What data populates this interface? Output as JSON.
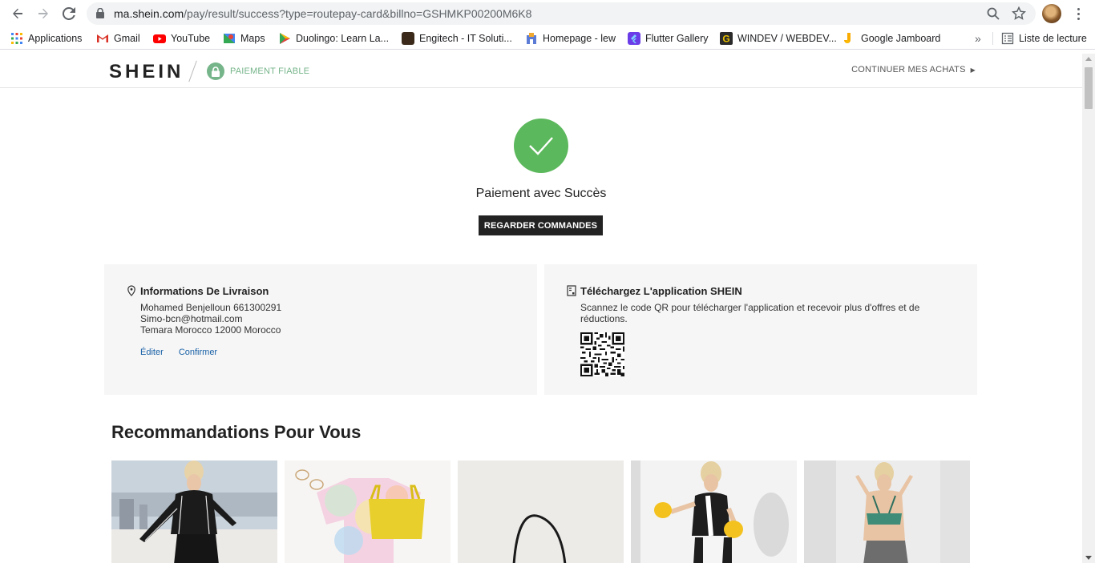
{
  "browser": {
    "url_host": "ma.shein.com",
    "url_path": "/pay/result/success?type=routepay-card&billno=GSHMKP00200M6K8",
    "bookmarks": [
      {
        "label": "Applications",
        "icon": "apps-grid-icon"
      },
      {
        "label": "Gmail",
        "icon": "gmail-icon",
        "color": "#d93025"
      },
      {
        "label": "YouTube",
        "icon": "youtube-icon",
        "color": "#ff0000"
      },
      {
        "label": "Maps",
        "icon": "maps-icon",
        "color": "#34a853"
      },
      {
        "label": "Duolingo: Learn La...",
        "icon": "play-store-icon",
        "color": "#4285f4"
      },
      {
        "label": "Engitech - IT Soluti...",
        "icon": "engitech-icon",
        "color": "#3b2a1a"
      },
      {
        "label": "Homepage - lew",
        "icon": "homepage-icon",
        "color": "#5b7bd5"
      },
      {
        "label": "Flutter Gallery",
        "icon": "flutter-icon",
        "color": "#6a3de8"
      },
      {
        "label": "WINDEV / WEBDEV...",
        "icon": "windev-icon",
        "color": "#c8a400"
      },
      {
        "label": "Google Jamboard",
        "icon": "jamboard-icon",
        "color": "#f9ab00"
      }
    ],
    "overflow_label": "»",
    "reading_list_label": "Liste de lecture"
  },
  "header": {
    "logo": "SHEIN",
    "secure_label": "PAIEMENT FIABLE",
    "continue_label": "CONTINUER MES ACHATS"
  },
  "success": {
    "title": "Paiement avec Succès",
    "orders_button": "REGARDER COMMANDES"
  },
  "delivery": {
    "title": "Informations De Livraison",
    "name_line": "Mohamed Benjelloun 661300291",
    "email": "Simo-bcn@hotmail.com",
    "address": "Temara Morocco 12000 Morocco",
    "edit_label": "Éditer",
    "confirm_label": "Confirmer"
  },
  "app": {
    "title": "Téléchargez L'application SHEIN",
    "description": "Scannez le code QR pour télécharger l'application et recevoir plus d'offres et de réductions."
  },
  "recommendations": {
    "title": "Recommandations Pour Vous",
    "products": [
      {
        "name": "product-black-sportswear"
      },
      {
        "name": "product-tie-dye-top"
      },
      {
        "name": "product-black-bag"
      },
      {
        "name": "product-boxing-set"
      },
      {
        "name": "product-green-sports-bra"
      }
    ]
  },
  "colors": {
    "success_green": "#5cb85c",
    "secure_green": "#76b58a",
    "link_blue": "#1860a6"
  }
}
